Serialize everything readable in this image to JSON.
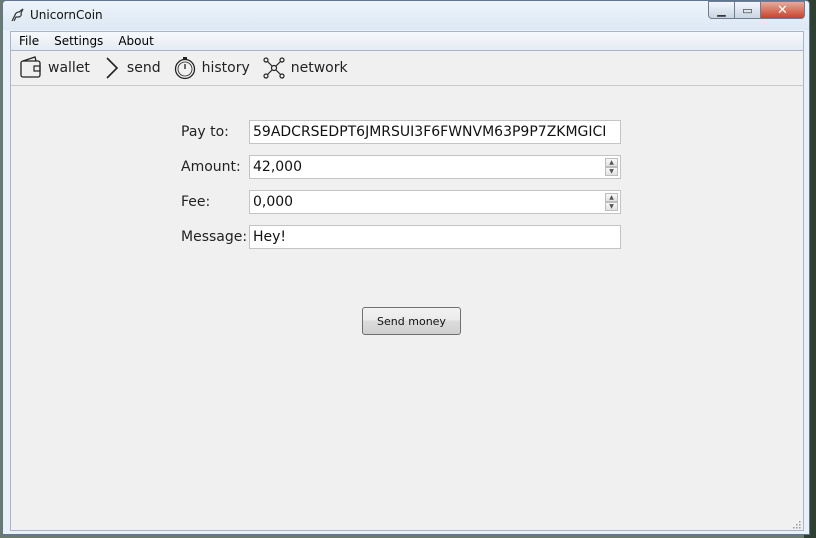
{
  "window": {
    "title": "UnicornCoin"
  },
  "menu": {
    "items": [
      "File",
      "Settings",
      "About"
    ]
  },
  "toolbar": {
    "items": [
      {
        "label": "wallet",
        "icon": "wallet-icon"
      },
      {
        "label": "send",
        "icon": "chevron-right-icon"
      },
      {
        "label": "history",
        "icon": "stopwatch-icon"
      },
      {
        "label": "network",
        "icon": "network-icon"
      }
    ]
  },
  "form": {
    "pay_to": {
      "label": "Pay to:",
      "value": "59ADCRSEDPT6JMRSUI3F6FWNVM63P9P7ZKMGICI"
    },
    "amount": {
      "label": "Amount:",
      "value": "42,000"
    },
    "fee": {
      "label": "Fee:",
      "value": "0,000"
    },
    "message": {
      "label": "Message:",
      "value": "Hey!"
    }
  },
  "actions": {
    "send_label": "Send money"
  }
}
